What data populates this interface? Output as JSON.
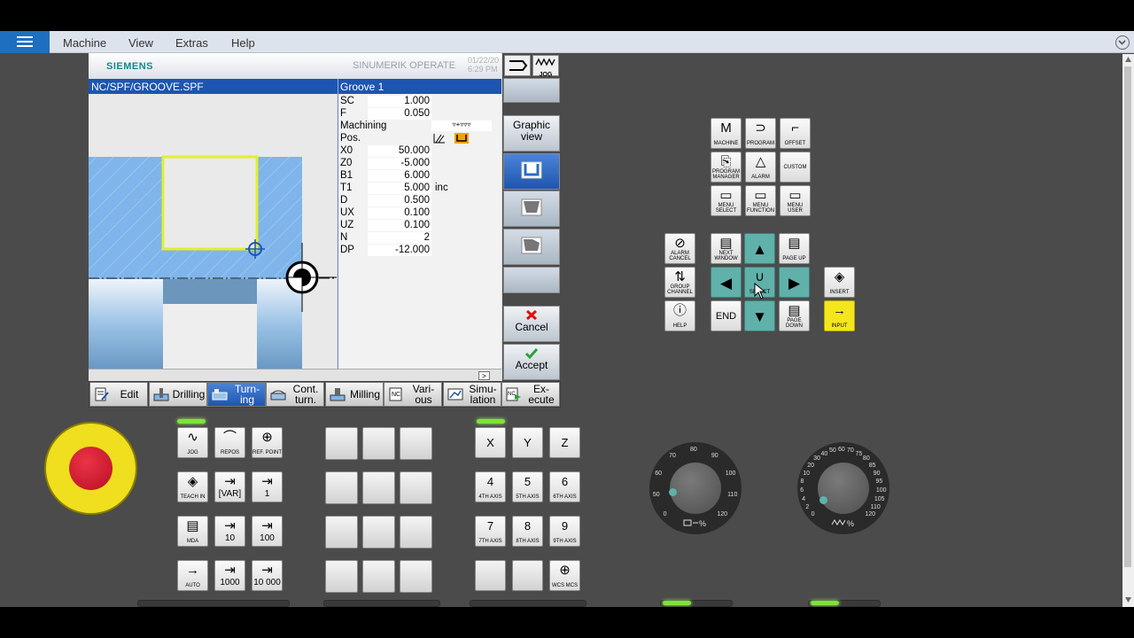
{
  "menubar": {
    "items": [
      "Machine",
      "View",
      "Extras",
      "Help"
    ]
  },
  "cnc": {
    "brand": "SIEMENS",
    "product": "SINUMERIK OPERATE",
    "date": "01/22/20",
    "time": "6:29 PM",
    "program_path": "NC/SPF/GROOVE.SPF",
    "cycle_title": "Groove 1",
    "top_right_labels": [
      "JOG"
    ],
    "params": [
      {
        "label": "SC",
        "value": "1.000",
        "unit": ""
      },
      {
        "label": "F",
        "value": "0.050",
        "unit": ""
      },
      {
        "label": "Machining",
        "value": "▿+▿▿▿",
        "unit": ""
      },
      {
        "label": "Pos.",
        "value": "",
        "unit": ""
      },
      {
        "label": "X0",
        "value": "50.000",
        "unit": ""
      },
      {
        "label": "Z0",
        "value": "-5.000",
        "unit": ""
      },
      {
        "label": "B1",
        "value": "6.000",
        "unit": ""
      },
      {
        "label": "T1",
        "value": "5.000",
        "unit": "inc"
      },
      {
        "label": "D",
        "value": "0.500",
        "unit": ""
      },
      {
        "label": "UX",
        "value": "0.100",
        "unit": ""
      },
      {
        "label": "UZ",
        "value": "0.100",
        "unit": ""
      },
      {
        "label": "N",
        "value": "2",
        "unit": ""
      },
      {
        "label": "DP",
        "value": "-12.000",
        "unit": ""
      }
    ],
    "vertical_softkeys": {
      "graphic_view": "Graphic view",
      "cancel": "Cancel",
      "accept": "Accept"
    },
    "horizontal_softkeys": [
      {
        "label": "Edit",
        "icon": "edit-icon"
      },
      {
        "label": "Drilling",
        "icon": "drilling-icon"
      },
      {
        "label": "Turn-\ning",
        "icon": "turning-icon",
        "selected": true
      },
      {
        "label": "Cont.\nturn.",
        "icon": "contour-turning-icon"
      },
      {
        "label": "Milling",
        "icon": "milling-icon"
      },
      {
        "label": "Vari-\nous",
        "icon": "various-icon"
      },
      {
        "label": "Simu-\nlation",
        "icon": "simulation-icon"
      },
      {
        "label": "Ex-\necute",
        "icon": "execute-icon"
      }
    ]
  },
  "keys": {
    "func": [
      "MACHINE",
      "PROGRAM",
      "OFFSET",
      "PROGRAM MANAGER",
      "ALARM",
      "CUSTOM",
      "MENU SELECT",
      "MENU FUNCTION",
      "MENU USER"
    ],
    "nav": {
      "alarm_cancel": "ALARM CANCEL",
      "next_window": "NEXT WINDOW",
      "page_up": "PAGE UP",
      "group_channel": "GROUP CHANNEL",
      "select": "SELECT",
      "insert": "INSERT",
      "help": "HELP",
      "end": "END",
      "page_down": "PAGE DOWN",
      "input": "INPUT"
    },
    "mode": [
      "JOG",
      "REPOS",
      "REF. POINT",
      "TEACH IN",
      "[VAR]",
      "1",
      "MDA",
      "10",
      "100",
      "AUTO",
      "1000",
      "10 000"
    ],
    "axis": [
      "X",
      "Y",
      "Z",
      "4",
      "5",
      "6",
      "7",
      "8",
      "9"
    ],
    "axis_sub": [
      "",
      "",
      "",
      "4TH AXIS",
      "5TH AXIS",
      "6TH AXIS",
      "7TH AXIS",
      "8TH AXIS",
      "9TH AXIS"
    ],
    "wcs": "WCS MCS"
  },
  "dials": {
    "feed": {
      "ticks": [
        "0",
        "50",
        "60",
        "70",
        "80",
        "90",
        "100",
        "110",
        "120"
      ],
      "label": "%"
    },
    "spindle": {
      "ticks": [
        "0",
        "2",
        "4",
        "6",
        "8",
        "10",
        "20",
        "30",
        "40",
        "50",
        "60",
        "70",
        "75",
        "80",
        "85",
        "90",
        "95",
        "100",
        "105",
        "110",
        "120"
      ],
      "label": "%"
    }
  },
  "colors": {
    "accent_blue": "#1d55b0",
    "input_yellow": "#f4e61d",
    "teal": "#5fb1aa",
    "emergency_red": "#d3152d"
  }
}
